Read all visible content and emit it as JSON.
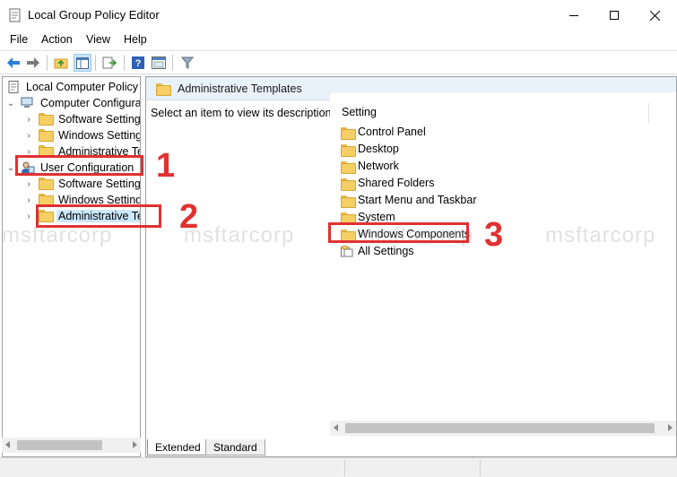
{
  "window": {
    "title": "Local Group Policy Editor",
    "controls": {
      "minimize": "—",
      "maximize": "☐",
      "close": "✕"
    }
  },
  "menubar": {
    "items": [
      {
        "label": "File"
      },
      {
        "label": "Action"
      },
      {
        "label": "View"
      },
      {
        "label": "Help"
      }
    ]
  },
  "toolbar": {
    "buttons": [
      "back-arrow-icon",
      "forward-arrow-icon",
      "up-folder-icon",
      "show-hide-tree-icon",
      "export-list-icon",
      "help-icon",
      "properties-icon",
      "filter-icon"
    ]
  },
  "tree": {
    "root": "Local Computer Policy",
    "computer_config": "Computer Configura",
    "cc_software": "Software Settings",
    "cc_windows": "Windows Setting",
    "cc_admin": "Administrative Te",
    "user_config": "User Configuration",
    "uc_software": "Software Settings",
    "uc_windows": "Windows Setting",
    "uc_admin": "Administrative Te"
  },
  "right_pane": {
    "header_title": "Administrative Templates",
    "description": "Select an item to view its description.",
    "column_header": "Setting",
    "items": [
      "Control Panel",
      "Desktop",
      "Network",
      "Shared Folders",
      "Start Menu and Taskbar",
      "System",
      "Windows Components",
      "All Settings"
    ]
  },
  "tabs": {
    "extended": "Extended",
    "standard": "Standard"
  },
  "annotations": {
    "step1": "1",
    "step2": "2",
    "step3": "3",
    "color": "#e03131"
  },
  "watermark": {
    "text": "msftarcorp"
  },
  "colors": {
    "selection": "#cce8ff",
    "header_band": "#e9f1fb",
    "folder": "#f5cf63"
  }
}
